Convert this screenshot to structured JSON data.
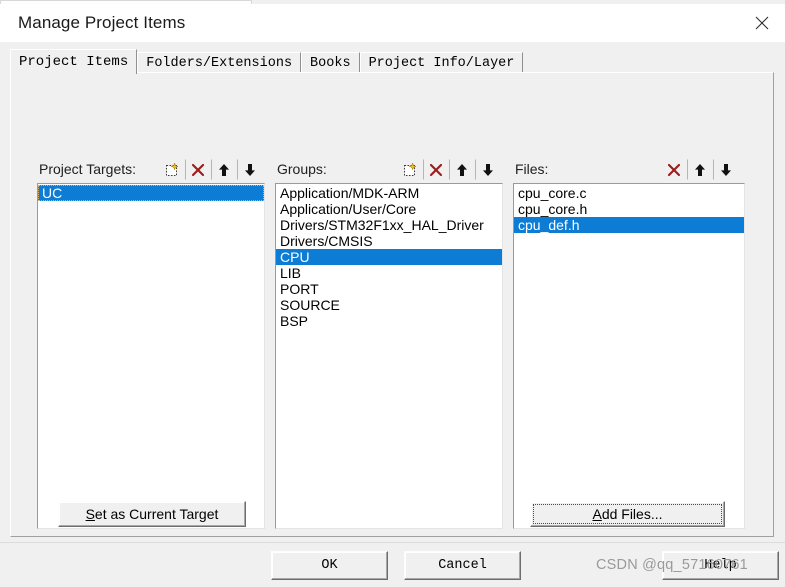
{
  "window": {
    "title": "Manage Project Items",
    "close_icon": "close-icon"
  },
  "tabs": [
    {
      "label": "Project Items",
      "active": true
    },
    {
      "label": "Folders/Extensions",
      "active": false
    },
    {
      "label": "Books",
      "active": false
    },
    {
      "label": "Project Info/Layer",
      "active": false
    }
  ],
  "columns": {
    "targets": {
      "label": "Project Targets:",
      "toolbar": [
        "new-item-icon",
        "delete-icon",
        "move-up-icon",
        "move-down-icon"
      ],
      "items": [
        {
          "label": "UC",
          "selected": true
        }
      ]
    },
    "groups": {
      "label": "Groups:",
      "toolbar": [
        "new-item-icon",
        "delete-icon",
        "move-up-icon",
        "move-down-icon"
      ],
      "items": [
        {
          "label": "Application/MDK-ARM",
          "selected": false
        },
        {
          "label": "Application/User/Core",
          "selected": false
        },
        {
          "label": "Drivers/STM32F1xx_HAL_Driver",
          "selected": false
        },
        {
          "label": "Drivers/CMSIS",
          "selected": false
        },
        {
          "label": "CPU",
          "selected": true
        },
        {
          "label": "LIB",
          "selected": false
        },
        {
          "label": "PORT",
          "selected": false
        },
        {
          "label": "SOURCE",
          "selected": false
        },
        {
          "label": "BSP",
          "selected": false
        }
      ]
    },
    "files": {
      "label": "Files:",
      "toolbar": [
        "delete-icon",
        "move-up-icon",
        "move-down-icon"
      ],
      "items": [
        {
          "label": "cpu_core.c",
          "selected": false
        },
        {
          "label": "cpu_core.h",
          "selected": false
        },
        {
          "label": "cpu_def.h",
          "selected": true
        }
      ]
    }
  },
  "buttons": {
    "set_current_target": {
      "accel": "S",
      "rest": "et as Current Target"
    },
    "add_files": {
      "accel": "A",
      "rest": "dd Files..."
    },
    "ok": "OK",
    "cancel": "Cancel",
    "help": "Help"
  },
  "watermark": "CSDN @qq_57160761",
  "colors": {
    "selection": "#0c7cd5",
    "delete_icon": "#9e1b1b",
    "face": "#f0f0f0"
  }
}
